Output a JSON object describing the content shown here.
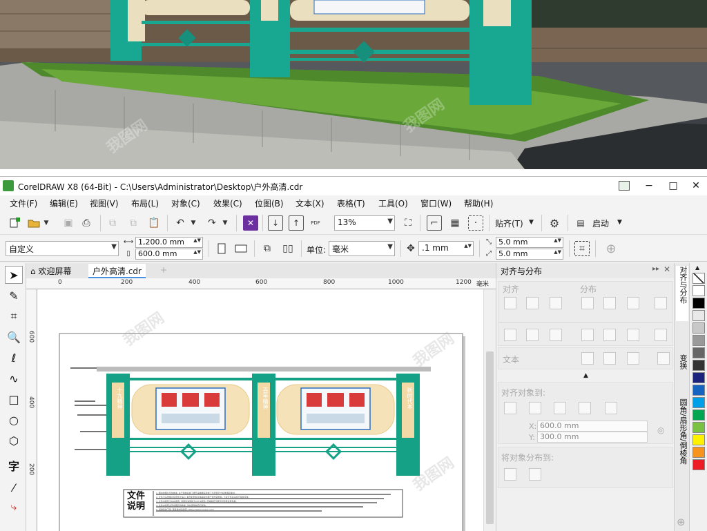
{
  "photo": {
    "watermark": "我图网"
  },
  "window": {
    "title": "CorelDRAW X8 (64-Bit) - C:\\Users\\Administrator\\Desktop\\户外高清.cdr",
    "minimize": "−",
    "maximize": "□",
    "close": "✕"
  },
  "menu": [
    "文件(F)",
    "编辑(E)",
    "视图(V)",
    "布局(L)",
    "对象(C)",
    "效果(C)",
    "位图(B)",
    "文本(X)",
    "表格(T)",
    "工具(O)",
    "窗口(W)",
    "帮助(H)"
  ],
  "toolbar1": {
    "zoom": "13%",
    "snap_label": "贴齐(T)",
    "launch_label": "启动",
    "pdf_label": "PDF"
  },
  "toolbar2": {
    "page_preset": "自定义",
    "width": "1,200.0 mm",
    "height": "600.0 mm",
    "units_label": "单位:",
    "units_value": "毫米",
    "nudge": ".1 mm",
    "dup_x": "5.0 mm",
    "dup_y": "5.0 mm"
  },
  "tabs": {
    "welcome": "欢迎屏幕",
    "document": "户外高清.cdr",
    "add": "+"
  },
  "ruler": {
    "h_ticks": [
      "0",
      "200",
      "400",
      "600",
      "800",
      "1000",
      "1200"
    ],
    "h_unit": "毫米",
    "v_ticks": [
      "600",
      "400",
      "200"
    ]
  },
  "canvas": {
    "panel1": "十九精神",
    "panel2": "百年精神",
    "panel3": "新时代本",
    "note_title": "文件说明",
    "note_lines": [
      "1. 图中的图片仅供参考, 关于到前后施工细节请根据实际施工与安装尺寸标准选取素材。",
      "2. 文件为矢量图可任意放大缩小, 制作时所有字体版权均属于原作者所有, 下载文件后请自行替换字体;",
      "3. 文件中颜色为RGB颜色, 印刷时请转换为CMYK颜色, 因电脑显示器不同可能会有色差;",
      "4. 文件中如有文字内容仅供参考, 请在使用前自行修改。",
      "5. 感谢您的下载, 更多素材请搜索: https://www.ooopic.com/"
    ]
  },
  "docker": {
    "title": "对齐与分布",
    "align_label": "对齐",
    "distribute_label": "分布",
    "text_label": "文本",
    "align_objects_to": "对齐对象到:",
    "x_value": "600.0 mm",
    "y_value": "300.0 mm",
    "distribute_objects_to": "将对象分布到:"
  },
  "sidetabs": {
    "tab1": "对齐与分布",
    "tab2": "变换",
    "tab3": "圆角/扇形角/倒棱角"
  },
  "palette": {
    "colors": [
      "#ffffff",
      "#000000",
      "#e9e9e9",
      "#c8c8c8",
      "#999999",
      "#666666",
      "#333333",
      "#1a237e",
      "#1565c0",
      "#00a0e9",
      "#00a651",
      "#7cc242",
      "#fff200",
      "#f7941d",
      "#ed1c24"
    ]
  }
}
